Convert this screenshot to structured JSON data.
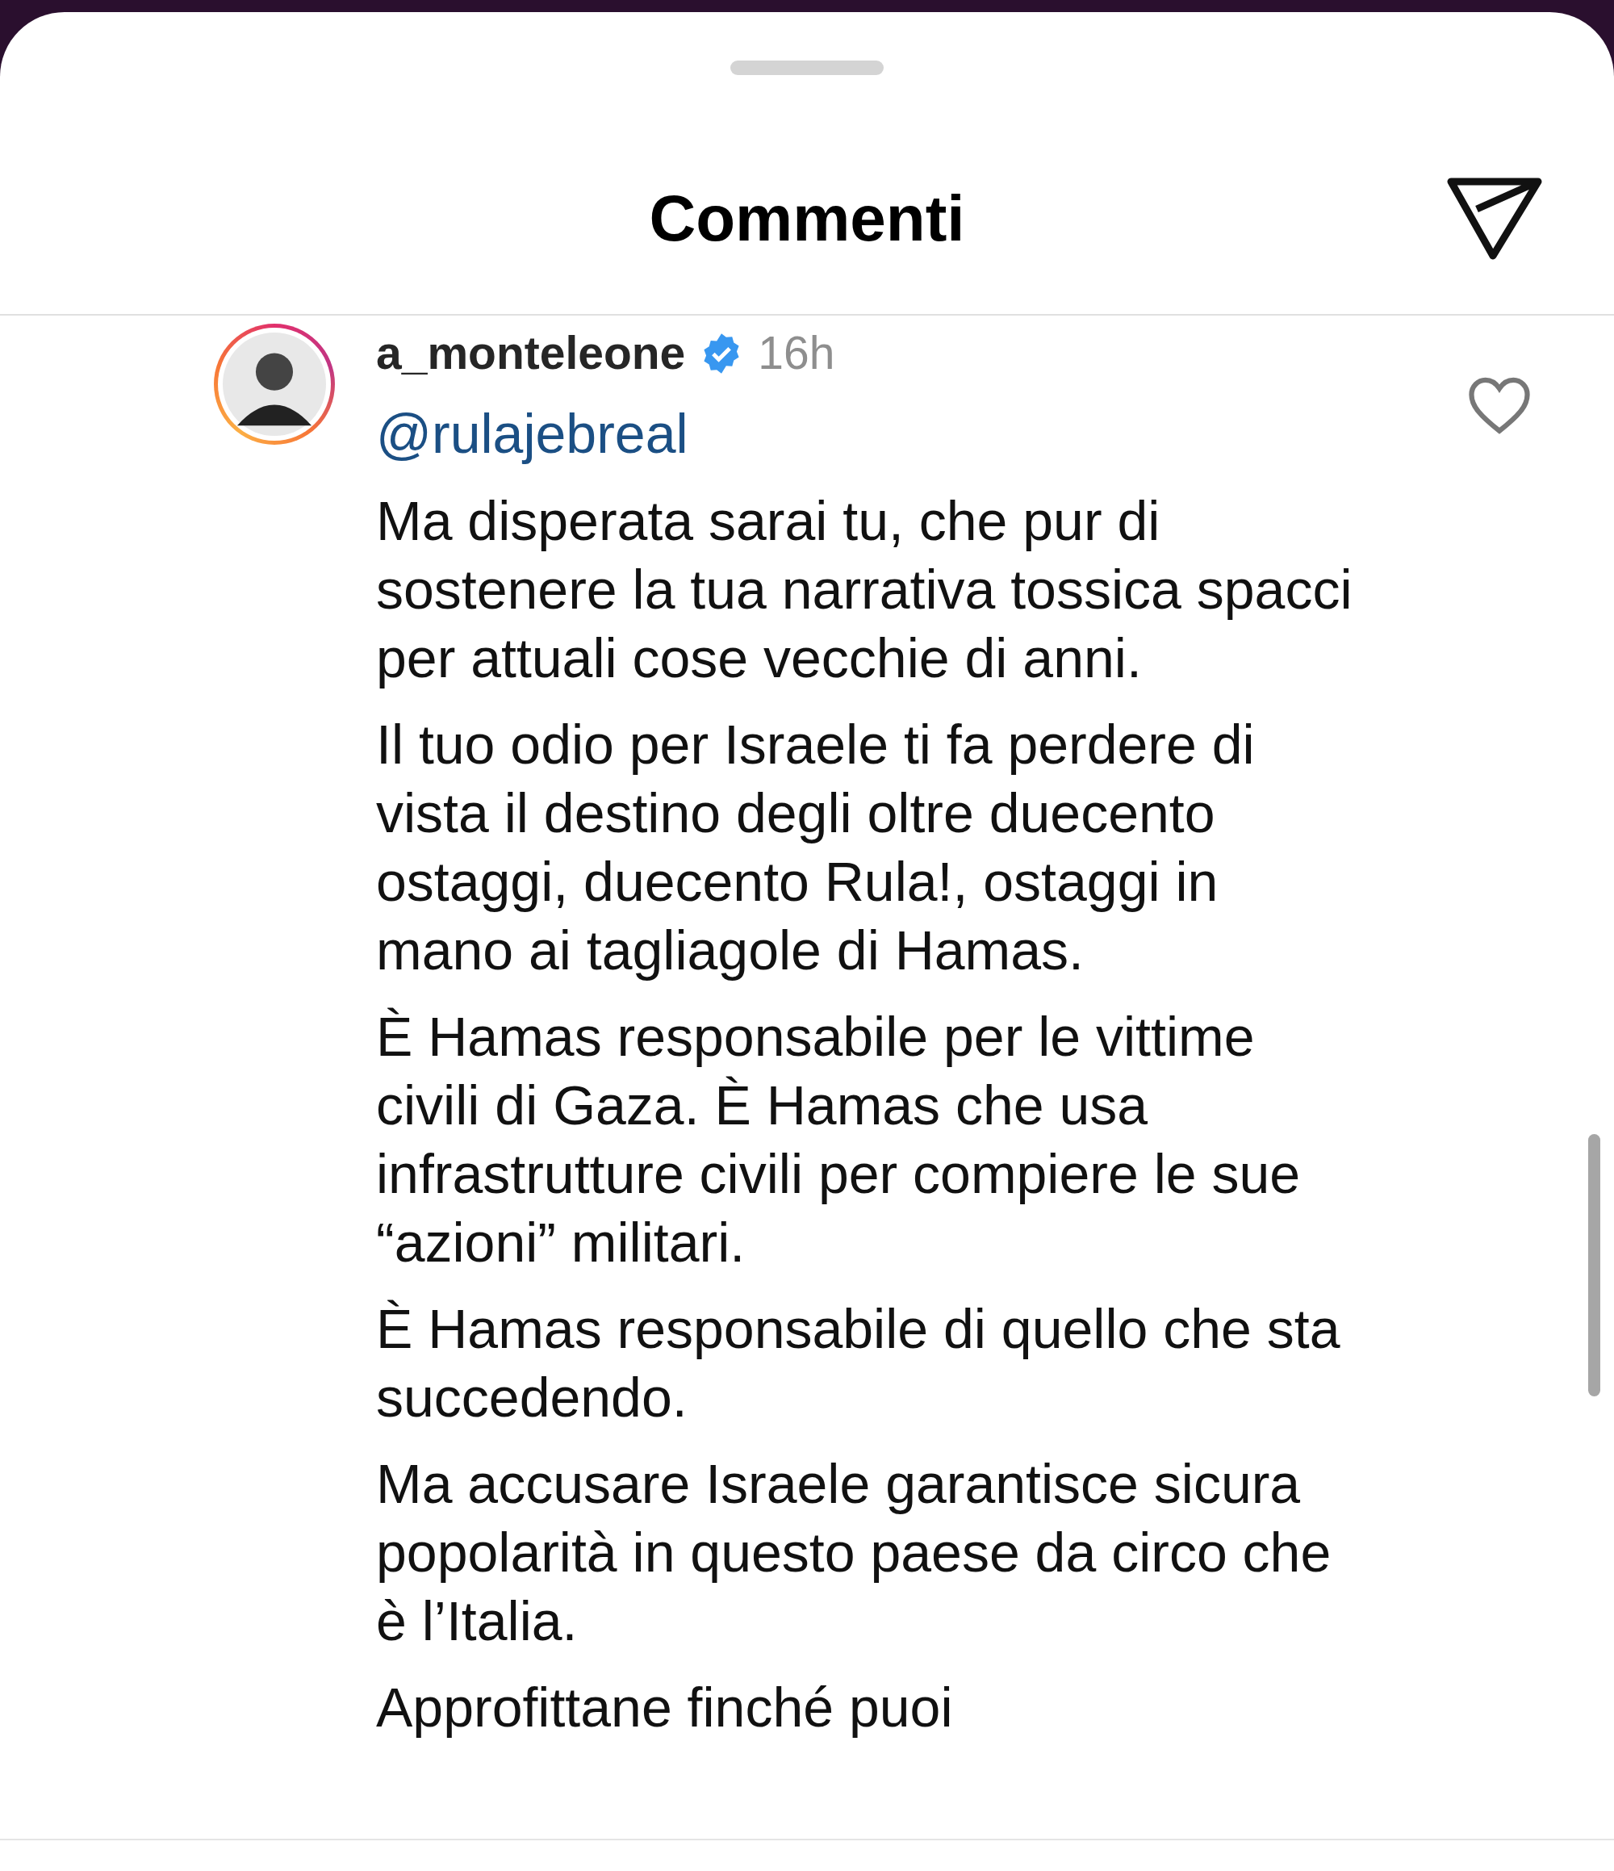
{
  "header": {
    "title": "Commenti"
  },
  "comment": {
    "username": "a_monteleone",
    "verified": true,
    "time": "16h",
    "liked": false,
    "mention": "@rulajebreal",
    "paragraphs": [
      "Ma disperata sarai tu, che pur di sostenere la tua narrativa tossica spacci per attuali cose vecchie di anni.",
      "Il tuo odio per Israele ti fa perdere di vista il destino degli oltre duecento ostaggi, duecento Rula!, ostaggi in mano ai tagliagole di Hamas.",
      "È Hamas responsabile per le vittime civili di Gaza. È Hamas che usa infrastrutture civili per compiere le sue “azioni” militari.",
      "È Hamas responsabile di quello che sta succedendo.",
      "Ma accusare Israele garantisce sicura popolarità in questo paese da circo che è l’Italia.",
      "Approfittane finché puoi"
    ]
  }
}
